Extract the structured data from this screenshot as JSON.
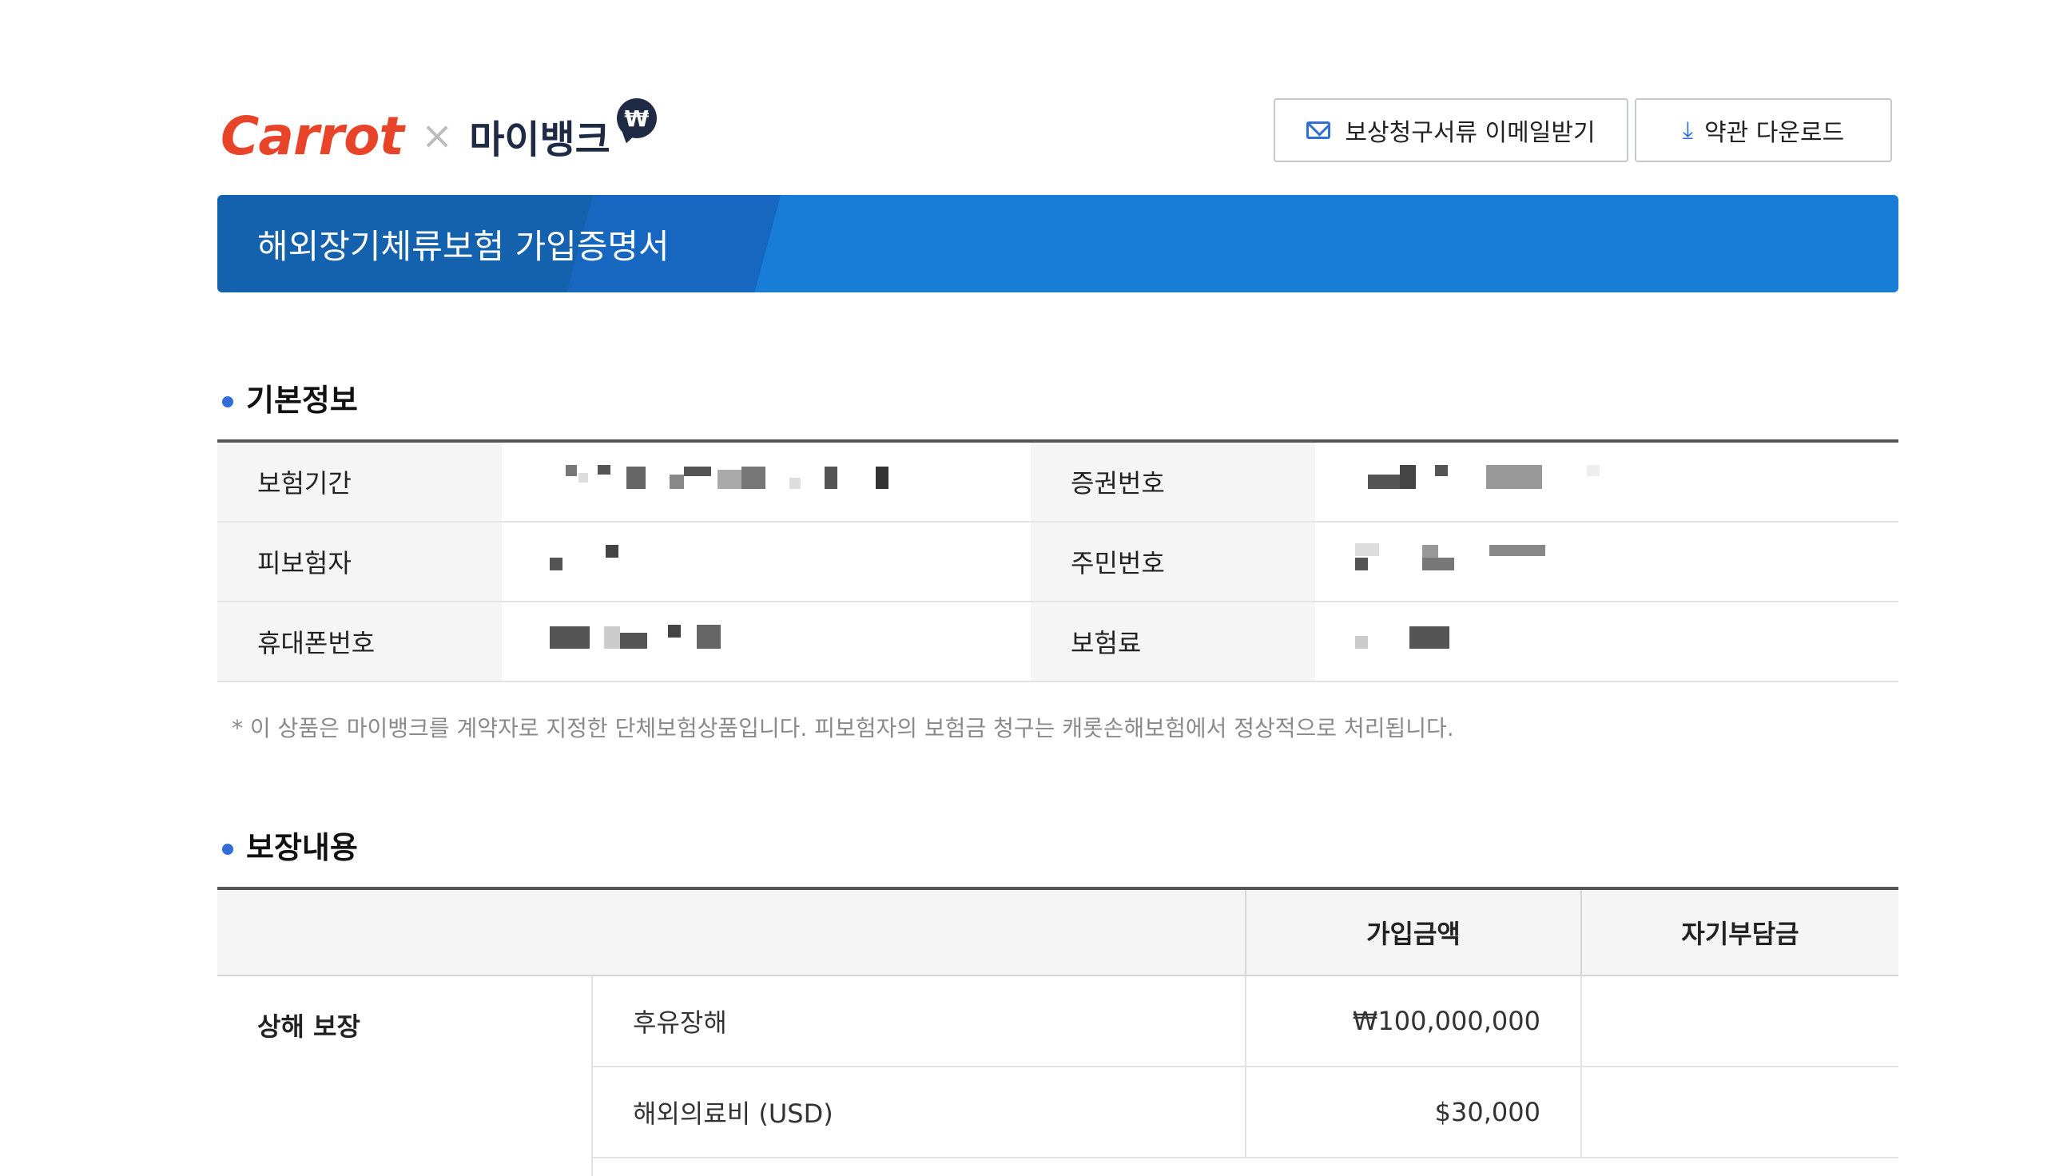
{
  "header": {
    "logo_carrot": "Carrot",
    "logo_times": "×",
    "logo_mybank": "마이뱅크",
    "logo_badge": "₩",
    "email_button": "보상청구서류 이메일받기",
    "terms_button": "약관 다운로드"
  },
  "banner": {
    "title": "해외장기체류보험 가입증명서"
  },
  "basic_info": {
    "heading": "기본정보",
    "rows": [
      {
        "label_left": "보험기간",
        "label_right": "증권번호"
      },
      {
        "label_left": "피보험자",
        "label_right": "주민번호"
      },
      {
        "label_left": "휴대폰번호",
        "label_right": "보험료"
      }
    ],
    "note": "* 이 상품은 마이뱅크를 계약자로 지정한 단체보험상품입니다. 피보험자의 보험금 청구는 캐롯손해보험에서 정상적으로 처리됩니다."
  },
  "coverage": {
    "heading": "보장내용",
    "col_amount": "가입금액",
    "col_deductible": "자기부담금",
    "category": "상해 보장",
    "items": [
      {
        "name": "후유장해",
        "amount": "₩100,000,000",
        "deductible": ""
      },
      {
        "name": "해외의료비 (USD)",
        "amount": "$30,000",
        "deductible": ""
      }
    ]
  },
  "colors": {
    "accent": "#2f6fd6",
    "banner": "#187dd6",
    "brand": "#e8442a"
  }
}
